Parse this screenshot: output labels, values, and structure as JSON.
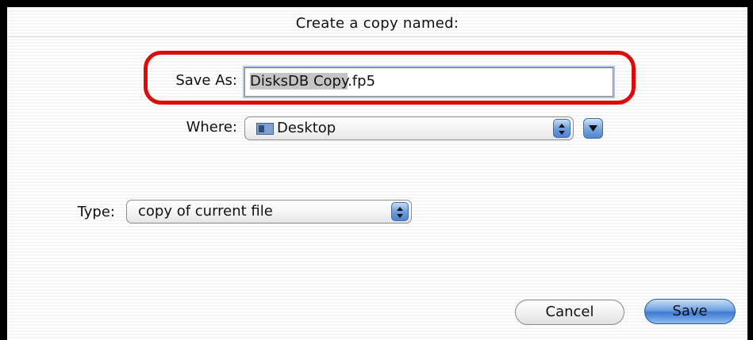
{
  "dialog": {
    "title": "Create a copy named:"
  },
  "save_as": {
    "label": "Save As:",
    "value_selected": "DisksDB Copy",
    "value_rest": ".fp5"
  },
  "where": {
    "label": "Where:",
    "selected": "Desktop",
    "icon": "folder-icon"
  },
  "type": {
    "label": "Type:",
    "selected": "copy of current file"
  },
  "buttons": {
    "cancel": "Cancel",
    "save": "Save"
  },
  "colors": {
    "highlight_ring": "#dc0c0c",
    "default_button": "#6da1e3"
  }
}
